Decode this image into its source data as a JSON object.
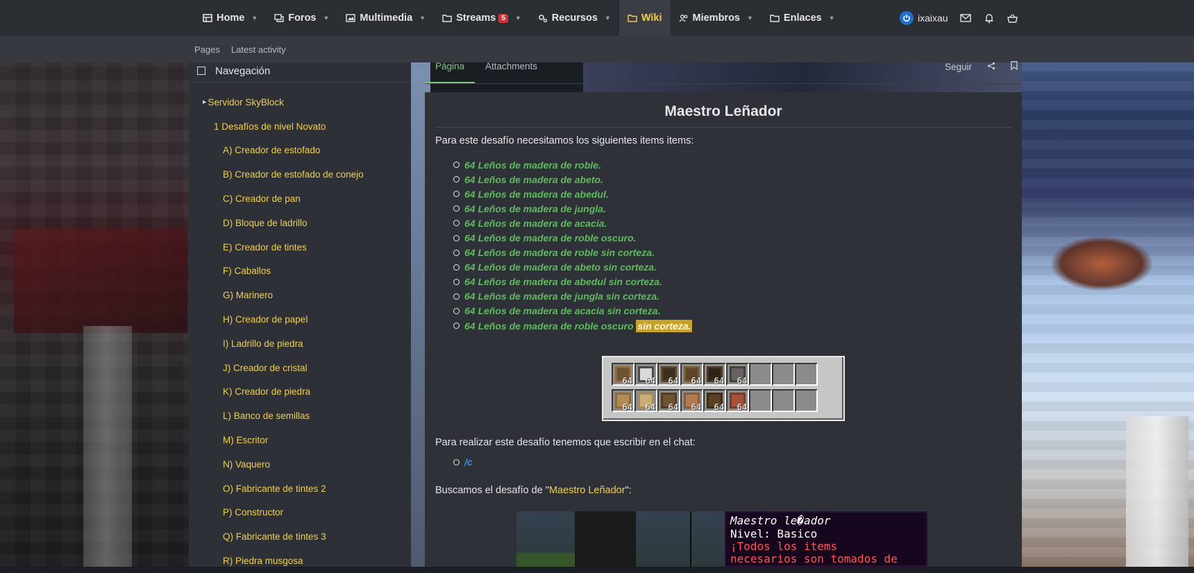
{
  "nav": {
    "items": [
      {
        "label": "Home",
        "icon": "home-icon"
      },
      {
        "label": "Foros",
        "icon": "chat-icon"
      },
      {
        "label": "Multimedia",
        "icon": "image-icon"
      },
      {
        "label": "Streams",
        "icon": "folder-icon",
        "badge": "5"
      },
      {
        "label": "Recursos",
        "icon": "gears-icon"
      },
      {
        "label": "Wiki",
        "icon": "folder-icon"
      },
      {
        "label": "Miembros",
        "icon": "users-icon"
      },
      {
        "label": "Enlaces",
        "icon": "folder-icon"
      }
    ],
    "username": "ixaixau",
    "accent": "#f2cf4d"
  },
  "subnav": {
    "pages": "Pages",
    "latest": "Latest activity"
  },
  "sidebar": {
    "heading": "Navegación",
    "items": [
      "Servidor SkyBlock",
      "1 Desafíos de nivel Novato",
      "A) Creador de estofado",
      "B) Creador de estofado de conejo",
      "C) Creador de pan",
      "D) Bloque de ladrillo",
      "E) Creador de tintes",
      "F) Caballos",
      "G) Marinero",
      "H) Creador de papel",
      "I) Ladrillo de piedra",
      "J) Creador de cristal",
      "K) Creador de piedra",
      "L) Banco de semillas",
      "M) Escritor",
      "N) Vaquero",
      "O) Fabricante de tintes 2",
      "P) Constructor",
      "Q) Fabricante de tintes 3",
      "R) Piedra musgosa"
    ]
  },
  "tabs": {
    "page": "Página",
    "attachments": "Attachments",
    "follow": "Seguir"
  },
  "article": {
    "title": "Maestro Leñador",
    "intro": "Para este desafío necesitamos los siguientes items items:",
    "items": [
      "64 Leños de madera de roble.",
      "64 Leños de madera de abeto.",
      "64 Leños de madera de abedul.",
      "64 Leños de madera de jungla.",
      "64 Leños de madera de acacia.",
      "64 Leños de madera de roble oscuro.",
      "64 Leños de madera de roble sin corteza.",
      "64 Leños de madera de abeto sin corteza.",
      "64 Leños de madera de abedul sin corteza.",
      "64 Leños de madera de jungla sin corteza.",
      "64 Leños de madera de acacia sin corteza."
    ],
    "last_item_prefix": "64 Leños de madera de roble oscuro ",
    "last_item_highlight": "sin corteza.",
    "inventory_count": "64",
    "chat_intro": "Para realizar este desafío tenemos que escribir en el chat:",
    "command": "/c",
    "search_prefix": "Buscamos el desafío de \"",
    "search_link": "Maestro Leñador",
    "search_suffix": "\":",
    "tooltip": {
      "title": "Maestro le�ador",
      "level": "Nivel: Basico",
      "red1": "¡Todos los items",
      "red2": "necesarios son tomados de"
    }
  }
}
